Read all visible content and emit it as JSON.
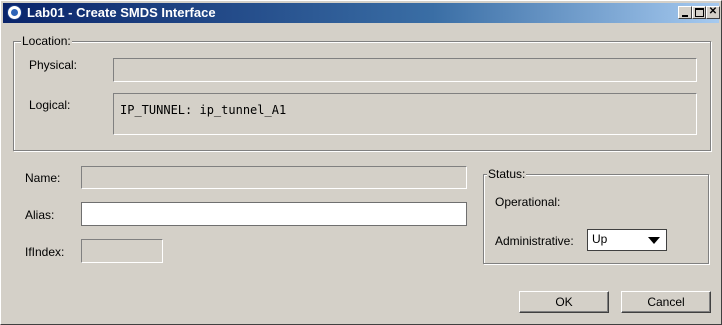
{
  "window": {
    "title": "Lab01 - Create SMDS Interface",
    "controls": [
      "minimize",
      "maximize",
      "close"
    ]
  },
  "location": {
    "legend": "Location:",
    "physical_label": "Physical:",
    "physical_value": "",
    "logical_label": "Logical:",
    "logical_value": "IP_TUNNEL: ip_tunnel_A1"
  },
  "form": {
    "name_label": "Name:",
    "name_value": "",
    "alias_label": "Alias:",
    "alias_value": "",
    "ifindex_label": "IfIndex:",
    "ifindex_value": ""
  },
  "status": {
    "legend": "Status:",
    "operational_label": "Operational:",
    "operational_value": "",
    "administrative_label": "Administrative:",
    "administrative_value": "Up"
  },
  "buttons": {
    "ok": "OK",
    "cancel": "Cancel"
  }
}
